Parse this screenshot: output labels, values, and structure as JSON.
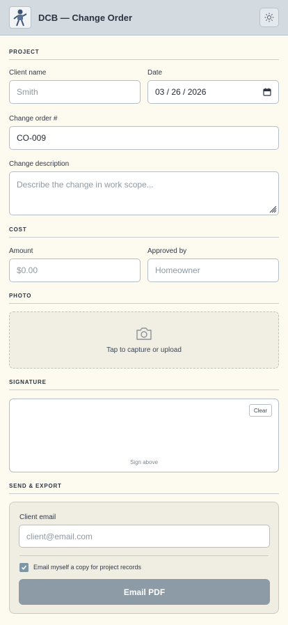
{
  "header": {
    "title": "DCB — Change Order",
    "logo_icon": "mascot-logo",
    "theme_icon": "sun-icon"
  },
  "project": {
    "section": "PROJECT",
    "client_label": "Client name",
    "client_placeholder": "Smith",
    "date_label": "Date",
    "date_value": "03 / 26 / 2026",
    "order_label": "Change order #",
    "order_value": "CO-009",
    "desc_label": "Change description",
    "desc_placeholder": "Describe the change in work scope..."
  },
  "cost": {
    "section": "COST",
    "amount_label": "Amount",
    "amount_placeholder": "$0.00",
    "approved_label": "Approved by",
    "approved_placeholder": "Homeowner"
  },
  "photo": {
    "section": "PHOTO",
    "prompt": "Tap to capture or upload",
    "icon": "camera-icon"
  },
  "signature": {
    "section": "SIGNATURE",
    "clear_label": "Clear",
    "hint": "Sign above"
  },
  "export": {
    "section": "SEND & EXPORT",
    "email_label": "Client email",
    "email_placeholder": "client@email.com",
    "copy_label": "Email myself a copy for project records",
    "copy_checked": true,
    "send_label": "Email PDF"
  }
}
